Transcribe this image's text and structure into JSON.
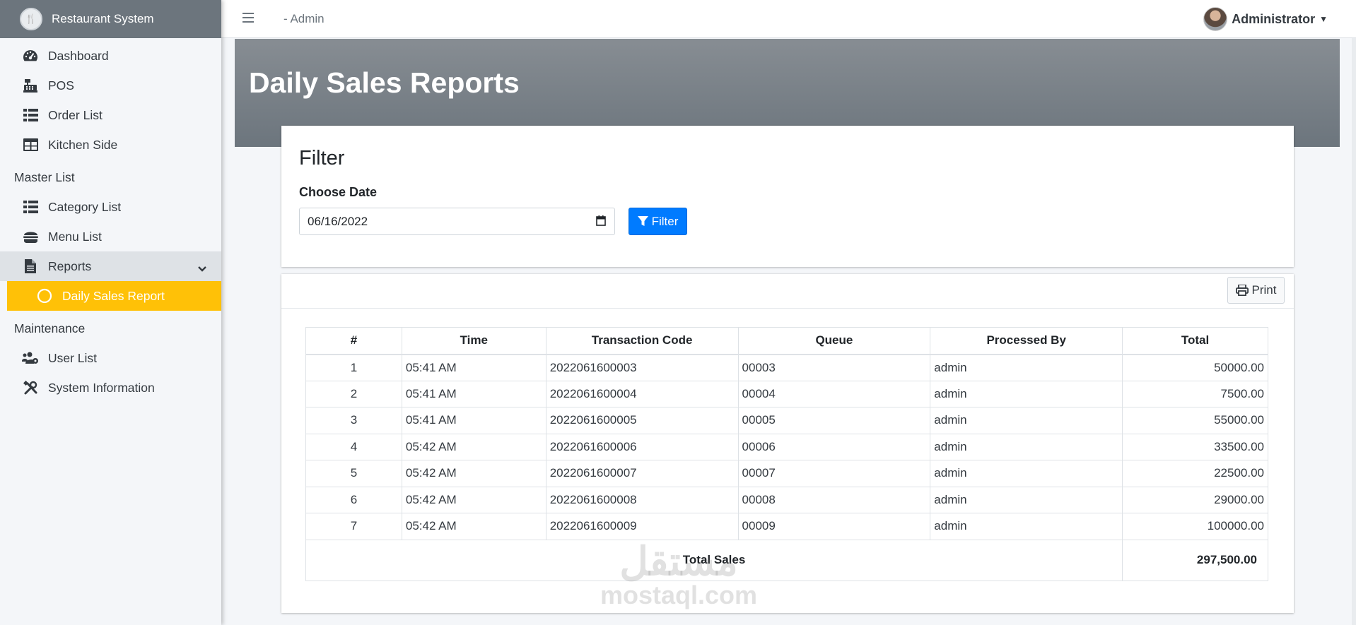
{
  "brand": {
    "name": "Restaurant System"
  },
  "topbar": {
    "title": "- Admin",
    "user_name": "Administrator"
  },
  "sidebar": {
    "items": [
      {
        "label": "Dashboard",
        "icon": "tachometer-icon"
      },
      {
        "label": "POS",
        "icon": "cash-register-icon"
      },
      {
        "label": "Order List",
        "icon": "list-icon"
      },
      {
        "label": "Kitchen Side",
        "icon": "table-icon"
      }
    ],
    "master_header": "Master List",
    "master_items": [
      {
        "label": "Category List",
        "icon": "list-icon"
      },
      {
        "label": "Menu List",
        "icon": "burger-icon"
      },
      {
        "label": "Reports",
        "icon": "file-icon"
      }
    ],
    "active_item": {
      "label": "Daily Sales Report",
      "icon": "circle-icon"
    },
    "maintenance_header": "Maintenance",
    "maintenance_items": [
      {
        "label": "User List",
        "icon": "users-cog-icon"
      },
      {
        "label": "System Information",
        "icon": "tools-icon"
      }
    ]
  },
  "page": {
    "title": "Daily Sales Reports"
  },
  "filter": {
    "title": "Filter",
    "date_label": "Choose Date",
    "date_value": "06/16/2022",
    "button_label": "Filter"
  },
  "report": {
    "print_label": "Print",
    "columns": [
      "#",
      "Time",
      "Transaction Code",
      "Queue",
      "Processed By",
      "Total"
    ],
    "rows": [
      [
        "1",
        "05:41 AM",
        "2022061600003",
        "00003",
        "admin",
        "50000.00"
      ],
      [
        "2",
        "05:41 AM",
        "2022061600004",
        "00004",
        "admin",
        "7500.00"
      ],
      [
        "3",
        "05:41 AM",
        "2022061600005",
        "00005",
        "admin",
        "55000.00"
      ],
      [
        "4",
        "05:42 AM",
        "2022061600006",
        "00006",
        "admin",
        "33500.00"
      ],
      [
        "5",
        "05:42 AM",
        "2022061600007",
        "00007",
        "admin",
        "22500.00"
      ],
      [
        "6",
        "05:42 AM",
        "2022061600008",
        "00008",
        "admin",
        "29000.00"
      ],
      [
        "7",
        "05:42 AM",
        "2022061600009",
        "00009",
        "admin",
        "100000.00"
      ]
    ],
    "total_label": "Total Sales",
    "total_value": "297,500.00"
  },
  "watermark": {
    "arabic": "مستقل",
    "latin": "mostaql.com"
  },
  "colors": {
    "accent": "#ffc107",
    "primary": "#007bff",
    "brand_bg": "#6c757d"
  }
}
